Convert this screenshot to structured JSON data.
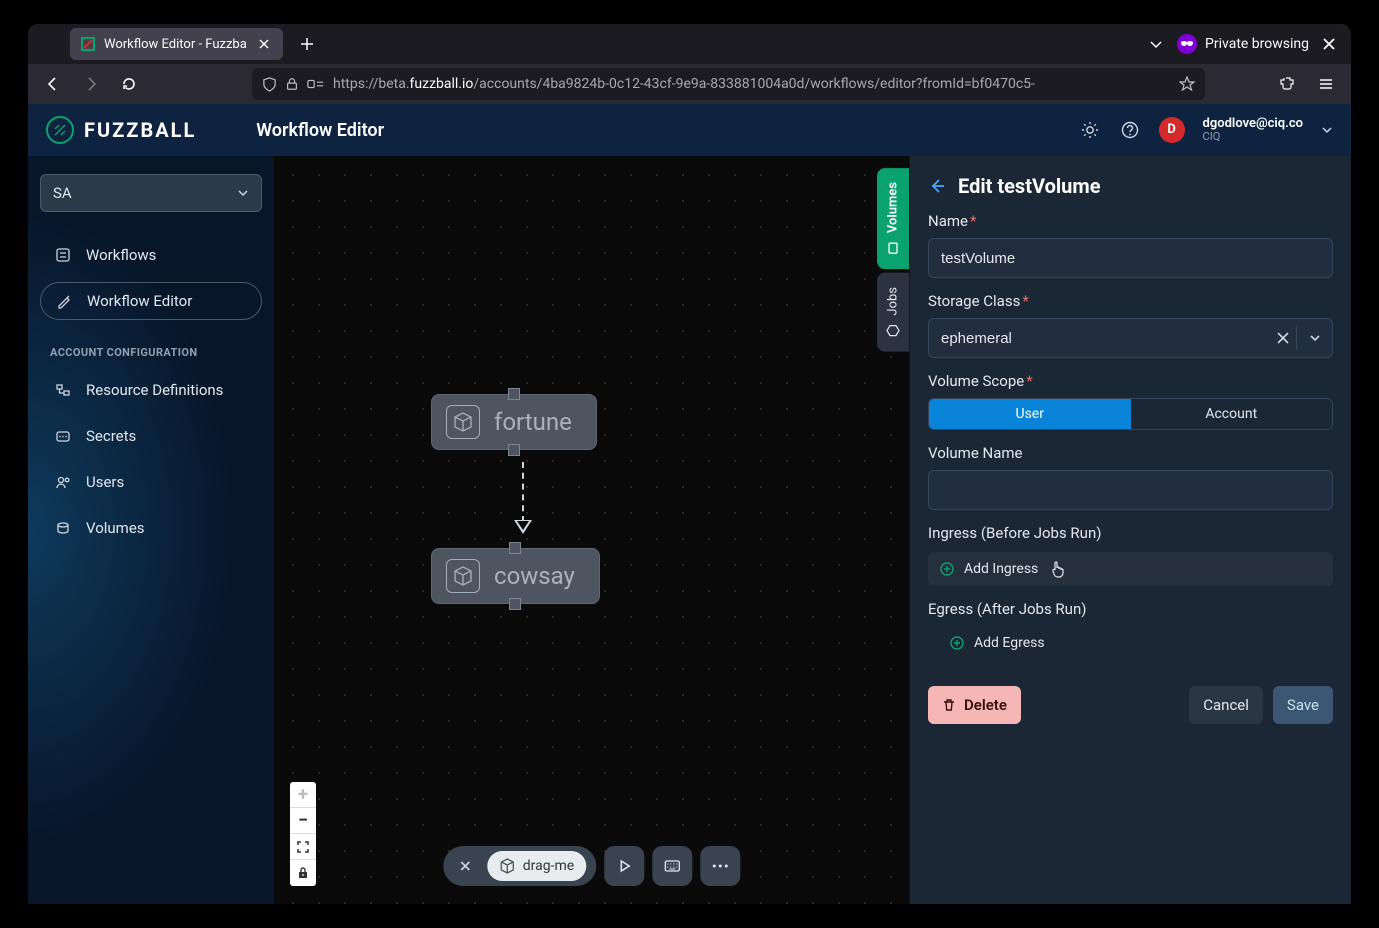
{
  "browser": {
    "tab_title": "Workflow Editor - Fuzzba",
    "private_label": "Private browsing",
    "url_protocol": "https://",
    "url_prefix": "beta.",
    "url_domain": "fuzzball.io",
    "url_path": "/accounts/4ba9824b-0c12-43cf-9e9a-833881004a0d/workflows/editor?fromId=bf0470c5-"
  },
  "header": {
    "brand": "FUZZBALL",
    "page_title": "Workflow Editor",
    "user_email": "dgodlove@ciq.co",
    "user_org": "CIQ",
    "avatar_letter": "D"
  },
  "sidebar": {
    "selector_value": "SA",
    "items_primary": [
      "Workflows",
      "Workflow Editor"
    ],
    "section_label": "ACCOUNT CONFIGURATION",
    "items_account": [
      "Resource Definitions",
      "Secrets",
      "Users",
      "Volumes"
    ]
  },
  "side_tabs": {
    "volumes": "Volumes",
    "jobs": "Jobs"
  },
  "canvas": {
    "node1_label": "fortune",
    "node2_label": "cowsay",
    "drag_chip": "drag-me"
  },
  "panel": {
    "title": "Edit testVolume",
    "name_label": "Name",
    "name_value": "testVolume",
    "storage_label": "Storage Class",
    "storage_value": "ephemeral",
    "scope_label": "Volume Scope",
    "scope_user": "User",
    "scope_account": "Account",
    "volname_label": "Volume Name",
    "volname_value": "",
    "ingress_label": "Ingress (Before Jobs Run)",
    "add_ingress": "Add Ingress",
    "egress_label": "Egress (After Jobs Run)",
    "add_egress": "Add Egress",
    "delete": "Delete",
    "cancel": "Cancel",
    "save": "Save"
  }
}
